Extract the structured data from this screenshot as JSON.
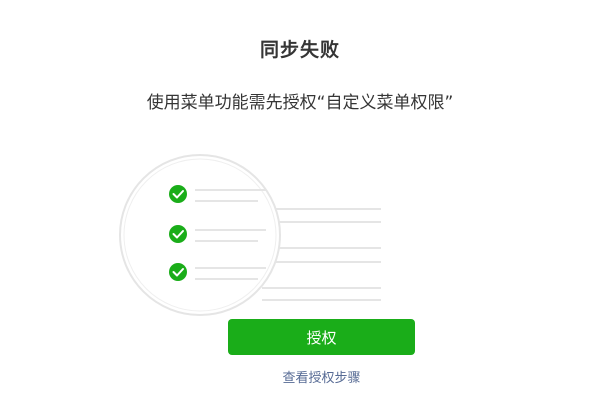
{
  "dialog": {
    "title": "同步失败",
    "message": "使用菜单功能需先授权“自定义菜单权限”",
    "authorize_button_label": "授权",
    "steps_link_label": "查看授权步骤"
  },
  "illustration": {
    "checked_items": 3,
    "check_icon": "check-circle-icon"
  },
  "colors": {
    "accent_green": "#1aad19",
    "link_blue": "#576b95",
    "line_gray": "#e5e5e5",
    "text_dark": "#353535"
  }
}
